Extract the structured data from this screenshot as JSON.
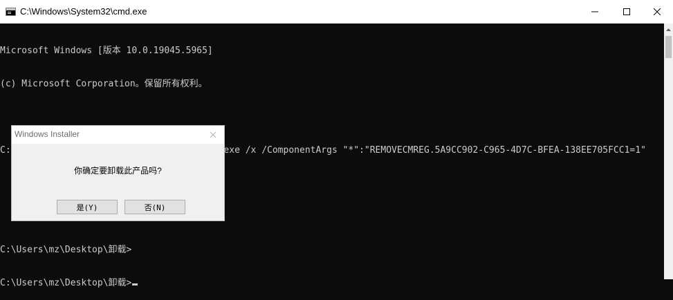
{
  "window": {
    "title": "C:\\Windows\\System32\\cmd.exe",
    "icon": "cmd-icon",
    "controls": [
      "minimize-icon",
      "maximize-icon",
      "close-icon"
    ]
  },
  "console": {
    "lines": [
      "Microsoft Windows [版本 10.0.19045.5965]",
      "(c) Microsoft Corporation。保留所有权利。",
      "",
      "C:\\Users\\mz\\Desktop\\卸载>CodeMeterRuntime.exe /x /ComponentArgs \"*\":\"REMOVECMREG.5A9CC902-C965-4D7C-BFEA-138EE705FCC1=1\"",
      "",
      "",
      "C:\\Users\\mz\\Desktop\\卸载>",
      "C:\\Users\\mz\\Desktop\\卸载>"
    ]
  },
  "dialog": {
    "title": "Windows Installer",
    "message": "你确定要卸载此产品吗?",
    "yes_label": "是(Y)",
    "no_label": "否(N)"
  }
}
